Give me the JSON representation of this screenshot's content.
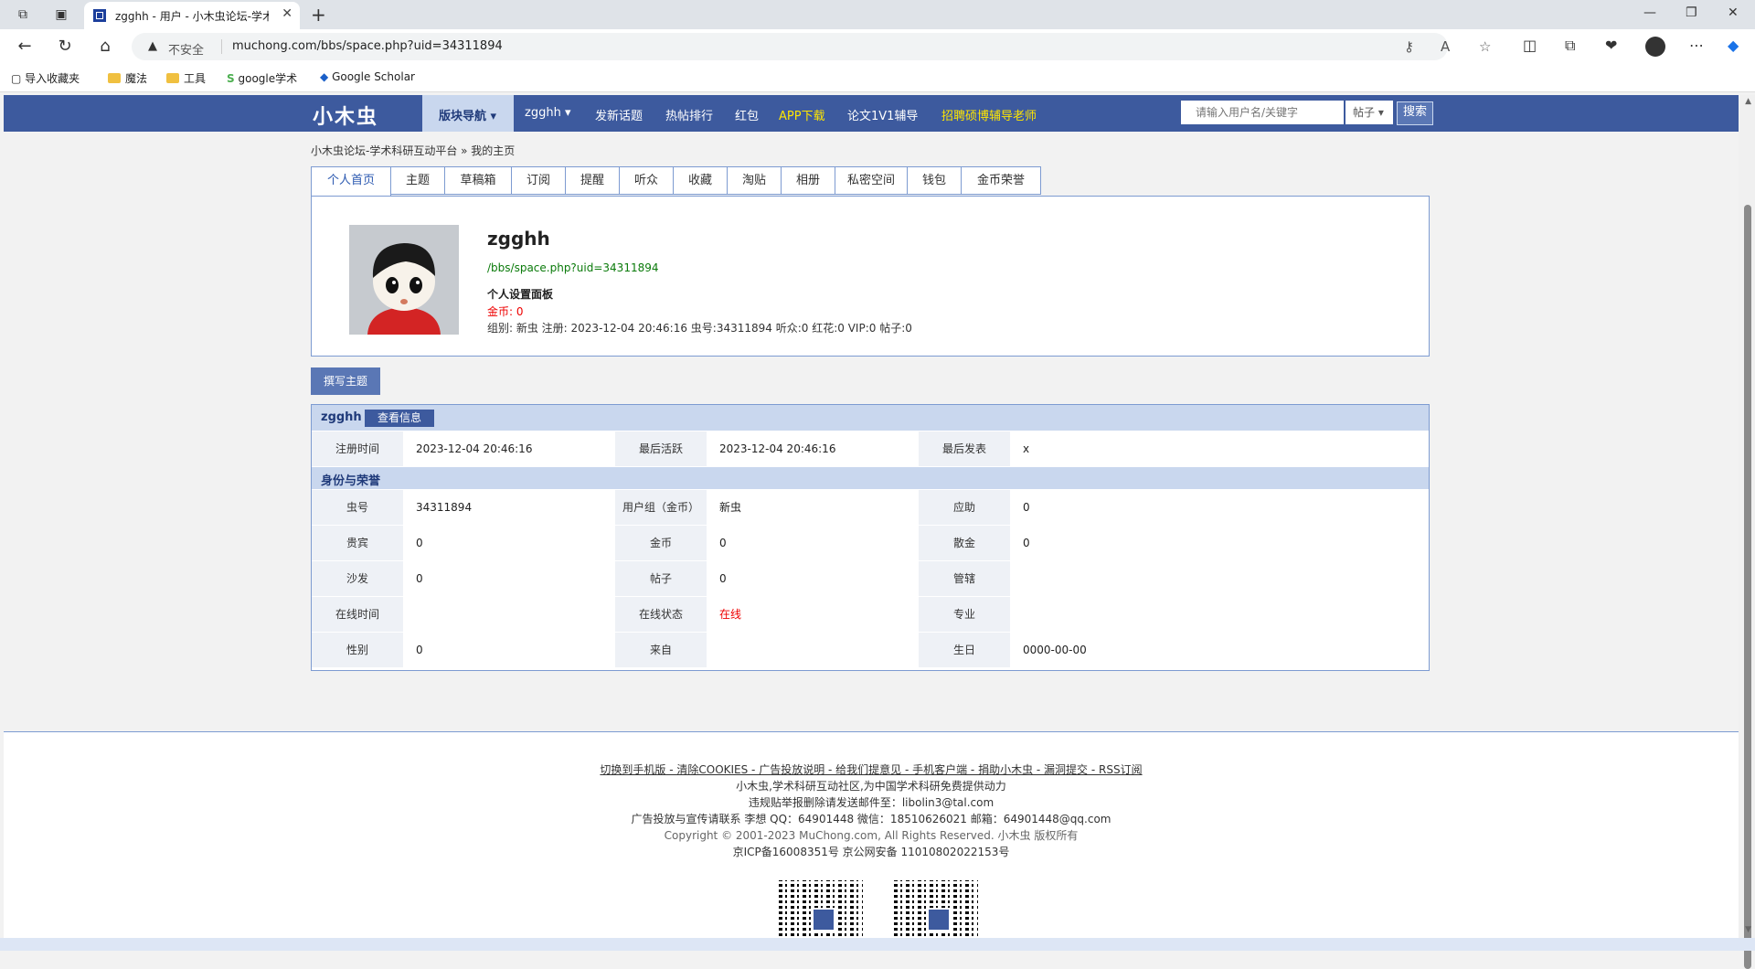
{
  "browser": {
    "tab_title": "zgghh - 用户 - 小木虫论坛-学术科",
    "address_insecure": "不安全",
    "url": "muchong.com/bbs/space.php?uid=34311894",
    "bookmarks": [
      "导入收藏夹",
      "魔法",
      "工具",
      "google学术",
      "Google Scholar"
    ]
  },
  "site": {
    "logo": "小木虫",
    "nav_selected": "版块导航 ▾",
    "nav": [
      "zgghh ▾",
      "发新话题",
      "热帖排行",
      "红包",
      "APP下载",
      "论文1V1辅导",
      "招聘硕博辅导老师"
    ],
    "search_placeholder": "请输入用户名/关键字",
    "search_type": "帖子 ▾",
    "search_button": "搜索"
  },
  "breadcrumb": "小木虫论坛-学术科研互动平台 » 我的主页",
  "profile_tabs": [
    "个人首页",
    "主题",
    "草稿箱",
    "订阅",
    "提醒",
    "听众",
    "收藏",
    "淘贴",
    "相册",
    "私密空间",
    "钱包",
    "金币荣誉"
  ],
  "profile": {
    "name": "zgghh",
    "link": "/bbs/space.php?uid=34311894",
    "settings": "个人设置面板",
    "coins": "金币: 0",
    "meta": "组别: 新虫   注册: 2023-12-04 20:46:16   虫号:34311894   听众:0   红花:0   VIP:0   帖子:0"
  },
  "write_button": "撰写主题",
  "info": {
    "user": "zgghh",
    "view_button": "查看信息",
    "row1": [
      "注册时间",
      "2023-12-04 20:46:16",
      "最后活跃",
      "2023-12-04 20:46:16",
      "最后发表",
      "x"
    ],
    "section2_title": "身份与荣誉",
    "rows": [
      [
        "虫号",
        "34311894",
        "用户组（金币）",
        "新虫",
        "应助",
        "0"
      ],
      [
        "贵宾",
        "0",
        "金币",
        "0",
        "散金",
        "0"
      ],
      [
        "沙发",
        "0",
        "帖子",
        "0",
        "管辖",
        ""
      ],
      [
        "在线时间",
        "",
        "在线状态",
        "在线",
        "专业",
        ""
      ],
      [
        "性别",
        "0",
        "来自",
        "",
        "生日",
        "0000-00-00"
      ]
    ]
  },
  "footer": {
    "links": "切换到手机版 - 清除COOKIES - 广告投放说明 - 给我们提意见 - 手机客户端 - 捐助小木虫 - 漏洞提交 -  RSS订阅",
    "line2": "小木虫,学术科研互动社区,为中国学术科研免费提供动力",
    "line3": "违规贴举报删除请发送邮件至：libolin3@tal.com",
    "line4": "广告投放与宣传请联系 李想 QQ：64901448 微信：18510626021 邮箱：64901448@qq.com",
    "line5": "Copyright © 2001-2023 MuChong.com, All Rights Reserved. 小木虫 版权所有",
    "line6": "京ICP备16008351号  京公网安备 11010802022153号"
  }
}
